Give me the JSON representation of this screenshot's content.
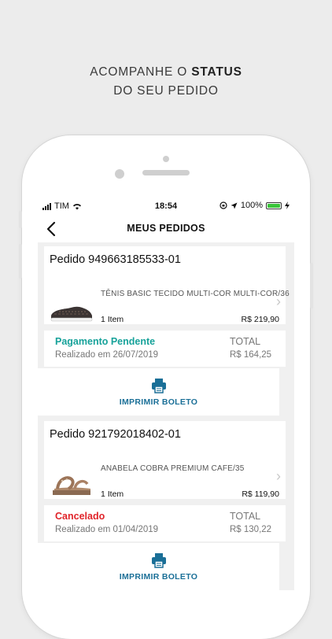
{
  "promo": {
    "line1_prefix": "ACOMPANHE O ",
    "line1_bold": "STATUS",
    "line2": "DO SEU PEDIDO"
  },
  "statusbar": {
    "carrier": "TIM",
    "time": "18:54",
    "battery": "100%"
  },
  "nav": {
    "title": "MEUS PEDIDOS"
  },
  "colors": {
    "pending": "#17a29a",
    "cancelled": "#e0242a",
    "action": "#1a6f97",
    "battery": "#3ac43a"
  },
  "orders": [
    {
      "title": "Pedido 949663185533-01",
      "product": "TÊNIS BASIC TECIDO MULTI-COR MULTI-COR/36",
      "items": "1 Item",
      "price": "R$  219,90",
      "status": "Pagamento Pendente",
      "date": "Realizado em 26/07/2019",
      "total_label": "TOTAL",
      "total_value": "R$  164,25",
      "action": "IMPRIMIR BOLETO",
      "product_icon": "sneaker-image"
    },
    {
      "title": "Pedido 921792018402-01",
      "product": "ANABELA COBRA PREMIUM CAFE/35",
      "items": "1 Item",
      "price": "R$  119,90",
      "status": "Cancelado",
      "date": "Realizado em 01/04/2019",
      "total_label": "TOTAL",
      "total_value": "R$  130,22",
      "action": "IMPRIMIR BOLETO",
      "product_icon": "sandal-image"
    }
  ]
}
